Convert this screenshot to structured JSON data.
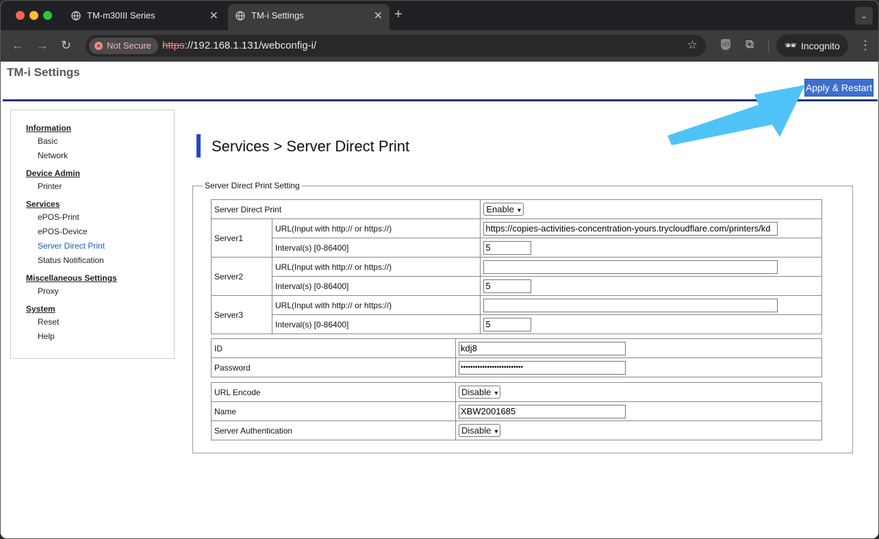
{
  "browser": {
    "tabs": [
      {
        "label": "TM-m30III Series"
      },
      {
        "label": "TM-i Settings"
      }
    ],
    "security_label": "Not Secure",
    "url_scheme": "https",
    "url_rest": "://192.168.1.131/webconfig-i/",
    "incognito_label": "Incognito"
  },
  "page": {
    "app_title": "TM-i Settings",
    "apply_button": "Apply & Restart",
    "heading": "Services > Server Direct Print"
  },
  "sidebar": {
    "groups": [
      {
        "title": "Information",
        "items": [
          "Basic",
          "Network"
        ]
      },
      {
        "title": "Device Admin",
        "items": [
          "Printer"
        ]
      },
      {
        "title": "Services",
        "items": [
          "ePOS-Print",
          "ePOS-Device",
          "Server Direct Print",
          "Status Notification"
        ]
      },
      {
        "title": "Miscellaneous Settings",
        "items": [
          "Proxy"
        ]
      },
      {
        "title": "System",
        "items": [
          "Reset",
          "Help"
        ]
      }
    ]
  },
  "form": {
    "legend": "Server Direct Print Setting",
    "server_direct_print": {
      "label": "Server Direct Print",
      "value": "Enable"
    },
    "url_label": "URL(Input with http:// or https://)",
    "interval_label": "Interval(s) [0-86400]",
    "servers": [
      {
        "name": "Server1",
        "url": "https://copies-activities-concentration-yours.trycloudflare.com/printers/kd",
        "interval": "5"
      },
      {
        "name": "Server2",
        "url": "",
        "interval": "5"
      },
      {
        "name": "Server3",
        "url": "",
        "interval": "5"
      }
    ],
    "id": {
      "label": "ID",
      "value": "kdj8"
    },
    "password": {
      "label": "Password",
      "value": "••••••••••••••••••••••••••"
    },
    "url_encode": {
      "label": "URL Encode",
      "value": "Disable"
    },
    "name": {
      "label": "Name",
      "value": "XBW2001685"
    },
    "server_auth": {
      "label": "Server Authentication",
      "value": "Disable"
    }
  },
  "colors": {
    "accent": "#3c6fd1",
    "arrow": "#4fc3f7",
    "rule": "#1b2f7a"
  }
}
